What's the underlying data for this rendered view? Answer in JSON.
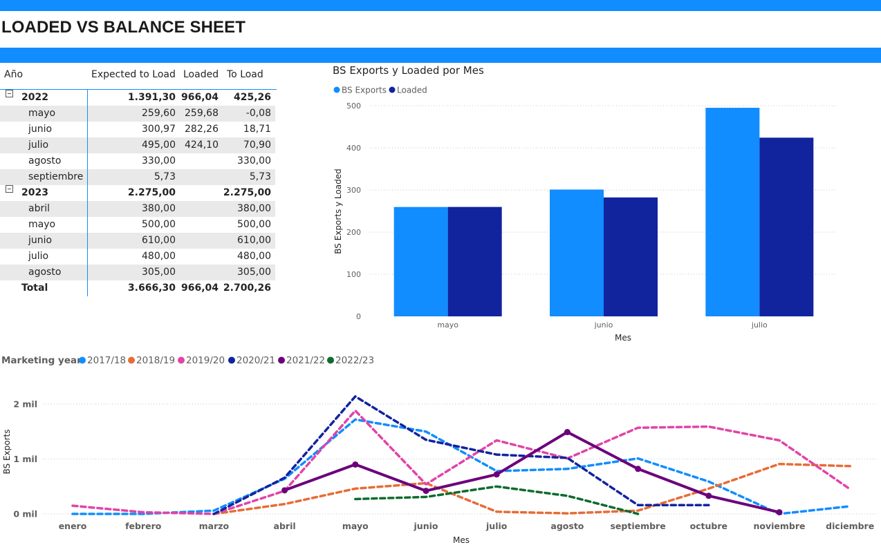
{
  "page": {
    "title": "LOADED VS BALANCE SHEET"
  },
  "colors": {
    "accent": "#118dff",
    "dark_blue": "#12239e",
    "row_alt": "#e9e9e9"
  },
  "matrix": {
    "columns": [
      "Año",
      "Expected to Load",
      "Loaded",
      "To Load"
    ],
    "rows": [
      {
        "kind": "group",
        "label": "2022",
        "expected": "1.391,30",
        "loaded": "966,04",
        "to_load": "425,26"
      },
      {
        "kind": "child",
        "label": "mayo",
        "expected": "259,60",
        "loaded": "259,68",
        "to_load": "-0,08"
      },
      {
        "kind": "child",
        "label": "junio",
        "expected": "300,97",
        "loaded": "282,26",
        "to_load": "18,71"
      },
      {
        "kind": "child",
        "label": "julio",
        "expected": "495,00",
        "loaded": "424,10",
        "to_load": "70,90"
      },
      {
        "kind": "child",
        "label": "agosto",
        "expected": "330,00",
        "loaded": "",
        "to_load": "330,00"
      },
      {
        "kind": "child",
        "label": "septiembre",
        "expected": "5,73",
        "loaded": "",
        "to_load": "5,73"
      },
      {
        "kind": "group",
        "label": "2023",
        "expected": "2.275,00",
        "loaded": "",
        "to_load": "2.275,00"
      },
      {
        "kind": "child",
        "label": "abril",
        "expected": "380,00",
        "loaded": "",
        "to_load": "380,00"
      },
      {
        "kind": "child",
        "label": "mayo",
        "expected": "500,00",
        "loaded": "",
        "to_load": "500,00"
      },
      {
        "kind": "child",
        "label": "junio",
        "expected": "610,00",
        "loaded": "",
        "to_load": "610,00"
      },
      {
        "kind": "child",
        "label": "julio",
        "expected": "480,00",
        "loaded": "",
        "to_load": "480,00"
      },
      {
        "kind": "child",
        "label": "agosto",
        "expected": "305,00",
        "loaded": "",
        "to_load": "305,00"
      },
      {
        "kind": "total",
        "label": "Total",
        "expected": "3.666,30",
        "loaded": "966,04",
        "to_load": "2.700,26"
      }
    ]
  },
  "chart_data": [
    {
      "type": "bar",
      "title": "BS Exports y Loaded por Mes",
      "xlabel": "Mes",
      "ylabel": "BS Exports y Loaded",
      "categories": [
        "mayo",
        "junio",
        "julio"
      ],
      "series": [
        {
          "name": "BS Exports",
          "color": "#118dff",
          "values": [
            259.6,
            300.97,
            495.0
          ]
        },
        {
          "name": "Loaded",
          "color": "#12239e",
          "values": [
            259.68,
            282.26,
            424.1
          ]
        }
      ],
      "ylim": [
        0,
        500
      ],
      "yticks": [
        0,
        100,
        200,
        300,
        400,
        500
      ],
      "grid": true,
      "legend_position": "top-left"
    },
    {
      "type": "line",
      "title": "",
      "legend_title": "Marketing year",
      "xlabel": "Mes",
      "ylabel": "BS Exports",
      "categories": [
        "enero",
        "febrero",
        "marzo",
        "abril",
        "mayo",
        "junio",
        "julio",
        "agosto",
        "septiembre",
        "octubre",
        "noviembre",
        "diciembre"
      ],
      "ylim": [
        0,
        2000
      ],
      "yticks": [
        {
          "value": 0,
          "label": "0 mil"
        },
        {
          "value": 1000,
          "label": "1 mil"
        },
        {
          "value": 2000,
          "label": "2 mil"
        }
      ],
      "grid": true,
      "legend_position": "top-left",
      "series": [
        {
          "name": "2017/18",
          "color": "#118dff",
          "style": "dashed",
          "values": [
            0,
            0,
            60,
            640,
            1720,
            1500,
            780,
            820,
            1010,
            590,
            0,
            140
          ]
        },
        {
          "name": "2018/19",
          "color": "#e66c37",
          "style": "dashed",
          "values": [
            null,
            null,
            0,
            180,
            460,
            560,
            40,
            10,
            60,
            460,
            910,
            870
          ]
        },
        {
          "name": "2019/20",
          "color": "#e044a7",
          "style": "dashed",
          "values": [
            150,
            30,
            0,
            420,
            1880,
            540,
            1340,
            1010,
            1570,
            1590,
            1340,
            450
          ]
        },
        {
          "name": "2020/21",
          "color": "#12239e",
          "style": "dashed",
          "values": [
            null,
            null,
            0,
            660,
            2140,
            1350,
            1080,
            1020,
            160,
            160,
            null,
            null
          ]
        },
        {
          "name": "2021/22",
          "color": "#6b007b",
          "style": "solid",
          "values": [
            null,
            null,
            null,
            430,
            900,
            420,
            720,
            1490,
            820,
            330,
            30,
            null
          ]
        },
        {
          "name": "2022/23",
          "color": "#0f6b2d",
          "style": "dashed",
          "values": [
            null,
            null,
            null,
            null,
            270,
            310,
            500,
            330,
            0,
            null,
            null,
            null
          ]
        }
      ]
    }
  ]
}
